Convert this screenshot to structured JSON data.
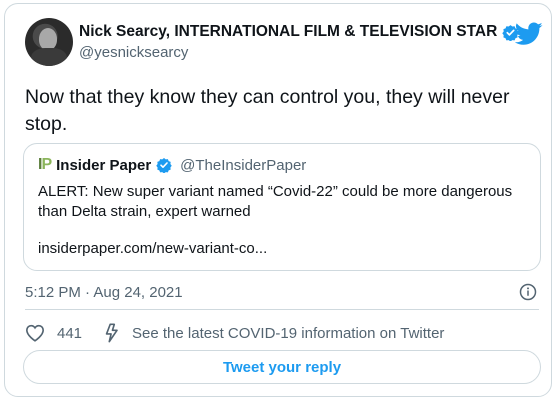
{
  "tweet": {
    "author": {
      "display_name": "Nick Searcy, INTERNATIONAL FILM & TELEVISION STAR",
      "handle": "@yesnicksearcy",
      "verified": true
    },
    "text": "Now that they know they can control you, they will never stop.",
    "timestamp": "5:12 PM · Aug 24, 2021",
    "like_count": "441",
    "covid_info_label": "See the latest COVID-19 information on Twitter",
    "reply_label": "Tweet your reply"
  },
  "quoted_tweet": {
    "logo_text": {
      "i": "I",
      "p": "P"
    },
    "display_name": "Insider Paper",
    "handle": "@TheInsiderPaper",
    "verified": true,
    "body": "ALERT: New super variant named “Covid-22” could be more dangerous than Delta strain, expert warned",
    "link": "insiderpaper.com/new-variant-co..."
  },
  "colors": {
    "accent": "#1d9bf0",
    "text": "#0f1419",
    "secondary_text": "#536471",
    "border": "#cfd9de"
  },
  "icons": [
    "twitter-bird-icon",
    "verified-badge-icon",
    "heart-icon",
    "covid-info-icon",
    "info-icon"
  ]
}
